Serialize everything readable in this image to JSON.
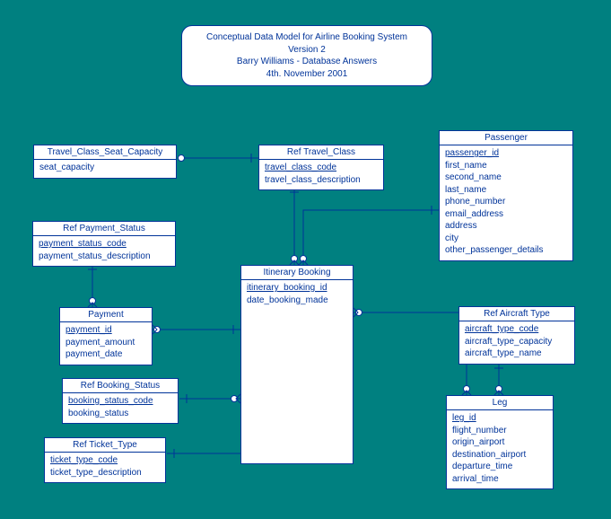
{
  "title": {
    "line1": "Conceptual Data Model for Airline Booking System",
    "line2": "Version 2",
    "line3": "Barry Williams - Database Answers",
    "line4": "4th. November 2001"
  },
  "entities": {
    "travel_class_seat_capacity": {
      "name": "Travel_Class_Seat_Capacity",
      "attrs": [
        "seat_capacity"
      ]
    },
    "ref_travel_class": {
      "name": "Ref Travel_Class",
      "attrs": [
        "travel_class_code",
        "travel_class_description"
      ],
      "pk": [
        "travel_class_code"
      ]
    },
    "passenger": {
      "name": "Passenger",
      "attrs": [
        "passenger_id",
        "first_name",
        "second_name",
        "last_name",
        "phone_number",
        "email_address",
        "address",
        "city",
        "other_passenger_details"
      ],
      "pk": [
        "passenger_id"
      ]
    },
    "ref_payment_status": {
      "name": "Ref Payment_Status",
      "attrs": [
        "payment_status_code",
        "payment_status_description"
      ],
      "pk": [
        "payment_status_code"
      ]
    },
    "itinerary_booking": {
      "name": "Itinerary Booking",
      "attrs": [
        "itinerary_booking_id",
        "date_booking_made"
      ],
      "pk": [
        "itinerary_booking_id"
      ]
    },
    "ref_aircraft_type": {
      "name": "Ref Aircraft Type",
      "attrs": [
        "aircraft_type_code",
        "aircraft_type_capacity",
        "aircraft_type_name"
      ],
      "pk": [
        "aircraft_type_code"
      ]
    },
    "payment": {
      "name": "Payment",
      "attrs": [
        "payment_id",
        "payment_amount",
        "payment_date"
      ],
      "pk": [
        "payment_id"
      ]
    },
    "ref_booking_status": {
      "name": "Ref Booking_Status",
      "attrs": [
        "booking_status_code",
        "booking_status"
      ],
      "pk": [
        "booking_status_code"
      ]
    },
    "leg": {
      "name": "Leg",
      "attrs": [
        "leg_id",
        "flight_number",
        "origin_airport",
        "destination_airport",
        "departure_time",
        "arrival_time"
      ],
      "pk": [
        "leg_id"
      ]
    },
    "ref_ticket_type": {
      "name": "Ref Ticket_Type",
      "attrs": [
        "ticket_type_code",
        "ticket_type_description"
      ],
      "pk": [
        "ticket_type_code"
      ]
    }
  }
}
